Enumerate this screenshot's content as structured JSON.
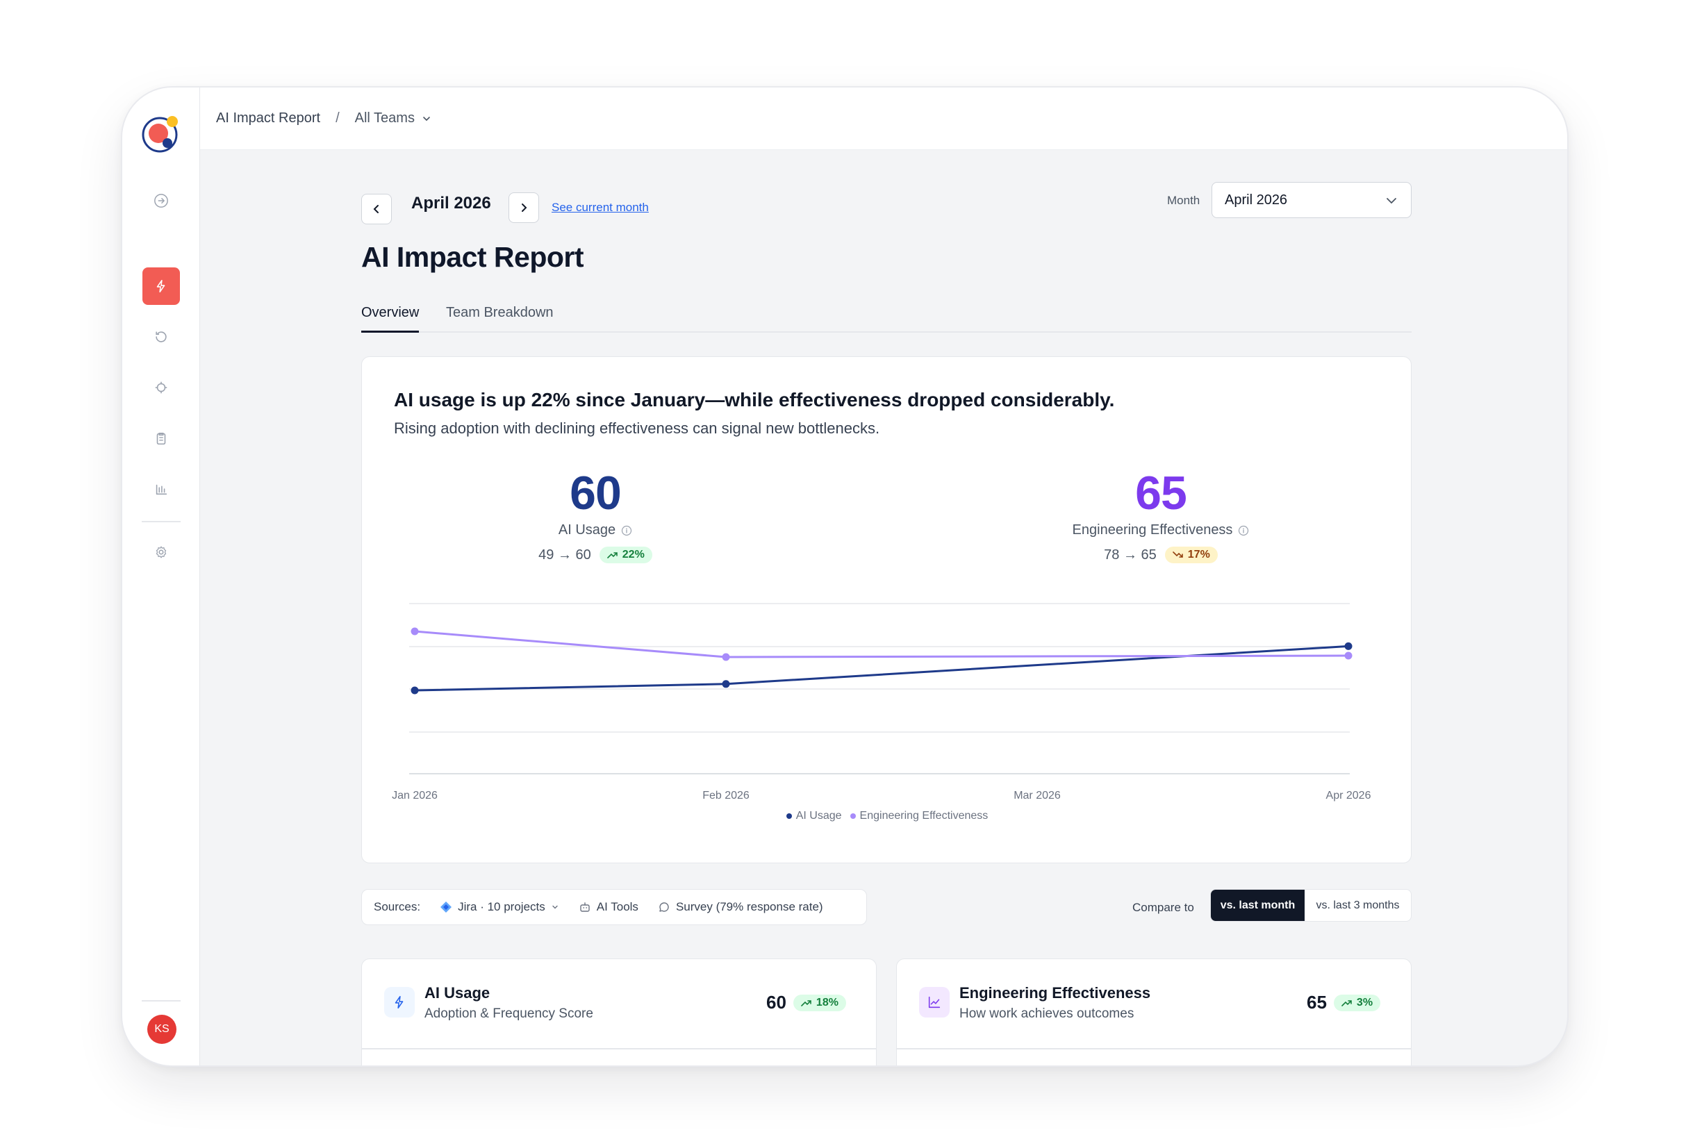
{
  "breadcrumb": {
    "report": "AI Impact Report",
    "separator": "/",
    "team": "All Teams"
  },
  "sidebar": {
    "items": [
      {
        "icon": "arrow-right-circle-icon"
      },
      {
        "icon": "lightning-icon",
        "active": true
      },
      {
        "icon": "history-icon"
      },
      {
        "icon": "target-icon"
      },
      {
        "icon": "clipboard-icon"
      },
      {
        "icon": "bar-chart-icon"
      },
      {
        "icon": "gear-icon"
      }
    ],
    "avatar_initials": "KS"
  },
  "month_nav": {
    "label": "April 2026",
    "see_current": "See current month"
  },
  "month_select": {
    "label": "Month",
    "value": "April 2026"
  },
  "page_title": "AI Impact Report",
  "tabs": [
    {
      "label": "Overview",
      "active": true
    },
    {
      "label": "Team Breakdown",
      "active": false
    }
  ],
  "hero": {
    "headline": "AI usage is up 22% since January—while effectiveness dropped considerably.",
    "subtext": "Rising adoption with declining effectiveness can signal new bottlenecks.",
    "kpis": [
      {
        "value": "60",
        "label": "AI Usage",
        "change": "49 → 60",
        "delta": "22%",
        "direction": "up",
        "color": "#1e3a8a"
      },
      {
        "value": "65",
        "label": "Engineering Effectiveness",
        "change": "78 → 65",
        "delta": "17%",
        "direction": "down",
        "color": "#7c3aed"
      }
    ]
  },
  "chart_data": {
    "type": "line",
    "x": [
      "Jan 2026",
      "Feb 2026",
      "Mar 2026",
      "Apr 2026"
    ],
    "series": [
      {
        "name": "AI Usage",
        "values": [
          49,
          51,
          null,
          60
        ],
        "color": "#1e3a8a"
      },
      {
        "name": "Engineering Effectiveness",
        "values": [
          78,
          63,
          null,
          65
        ],
        "color": "#a78bfa"
      }
    ],
    "grid": true,
    "legend": "bottom-center"
  },
  "sources": {
    "label": "Sources:",
    "items": [
      {
        "icon": "jira-icon",
        "text": "Jira · 10 projects"
      },
      {
        "icon": "robot-icon",
        "text": "AI Tools"
      },
      {
        "icon": "chat-bubble-icon",
        "text": "Survey (79% response rate)"
      }
    ]
  },
  "compare": {
    "label": "Compare to",
    "options": [
      "vs. last month",
      "vs. last 3 months"
    ],
    "selected": "vs. last month"
  },
  "cards": [
    {
      "title": "AI Usage",
      "subtitle": "Adoption & Frequency Score",
      "score": "60",
      "delta": "18%",
      "icon": "lightning-icon",
      "accent": "#2563eb"
    },
    {
      "title": "Engineering Effectiveness",
      "subtitle": "How work achieves outcomes",
      "score": "65",
      "delta": "3%",
      "icon": "line-chart-icon",
      "accent": "#7c3aed"
    }
  ]
}
